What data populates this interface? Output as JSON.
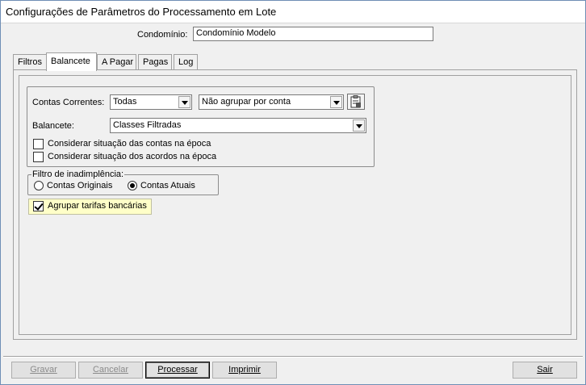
{
  "window": {
    "title": "Configurações de Parâmetros do Processamento em Lote"
  },
  "header": {
    "condominio_label": "Condomínio:",
    "condominio_value": "Condomínio Modelo"
  },
  "tabs": [
    {
      "label": "Filtros"
    },
    {
      "label": "Balancete"
    },
    {
      "label": "A Pagar"
    },
    {
      "label": "Pagas"
    },
    {
      "label": "Log"
    }
  ],
  "active_tab": "Balancete",
  "balancete": {
    "contas_correntes_label": "Contas Correntes:",
    "contas_correntes_value": "Todas",
    "agrupar_conta_value": "Não agrupar por conta",
    "balancete_label": "Balancete:",
    "balancete_value": "Classes Filtradas",
    "chk_situacao_contas": {
      "label": "Considerar situação das contas na época",
      "checked": false
    },
    "chk_situacao_acordos": {
      "label": "Considerar situação dos acordos na época",
      "checked": false
    },
    "filtro_inadimplencia": {
      "title": "Filtro de inadimplência:",
      "options": [
        {
          "label": "Contas Originais",
          "selected": false
        },
        {
          "label": "Contas Atuais",
          "selected": true
        }
      ]
    },
    "chk_agrupar_tarifas": {
      "label": "Agrupar tarifas bancárias",
      "checked": true
    }
  },
  "buttons": {
    "gravar": "Gravar",
    "cancelar": "Cancelar",
    "processar": "Processar",
    "imprimir": "Imprimir",
    "sair": "Sair"
  }
}
